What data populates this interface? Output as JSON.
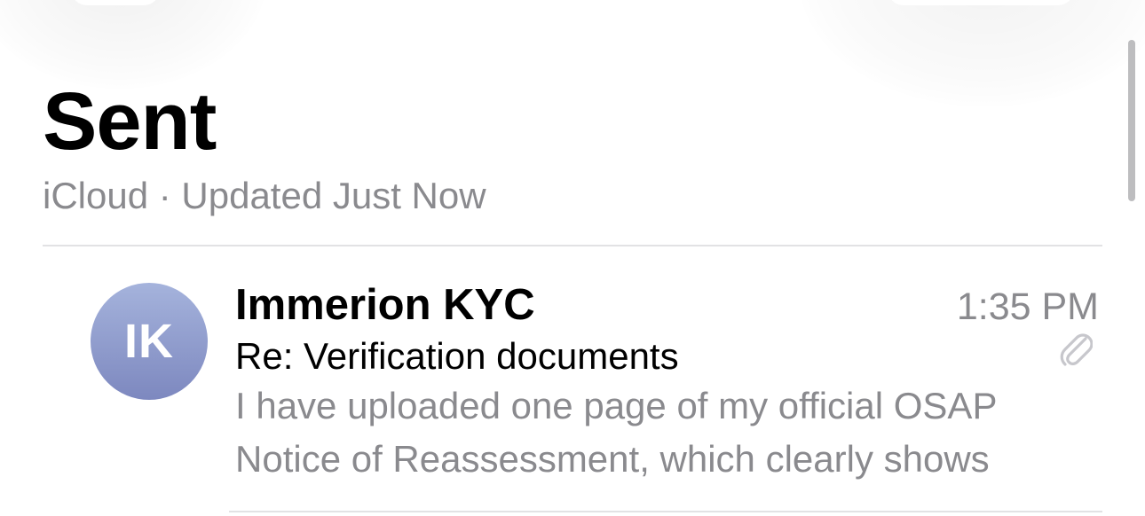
{
  "header": {
    "title": "Sent",
    "subtitle": "iCloud · Updated Just Now"
  },
  "messages": [
    {
      "avatar_initials": "IK",
      "sender": "Immerion KYC",
      "time": "1:35 PM",
      "subject": "Re: Verification documents",
      "has_attachment": true,
      "attachment_icon": "paperclip-icon",
      "preview_lines": [
        "I have uploaded one page of my official OSAP",
        "Notice of Reassessment, which clearly shows"
      ]
    }
  ],
  "colors": {
    "avatar_gradient_top": "#a5b3dc",
    "avatar_gradient_bottom": "#7d88bf",
    "secondary_text": "#8a8a8e",
    "divider": "#e2e2e4"
  }
}
